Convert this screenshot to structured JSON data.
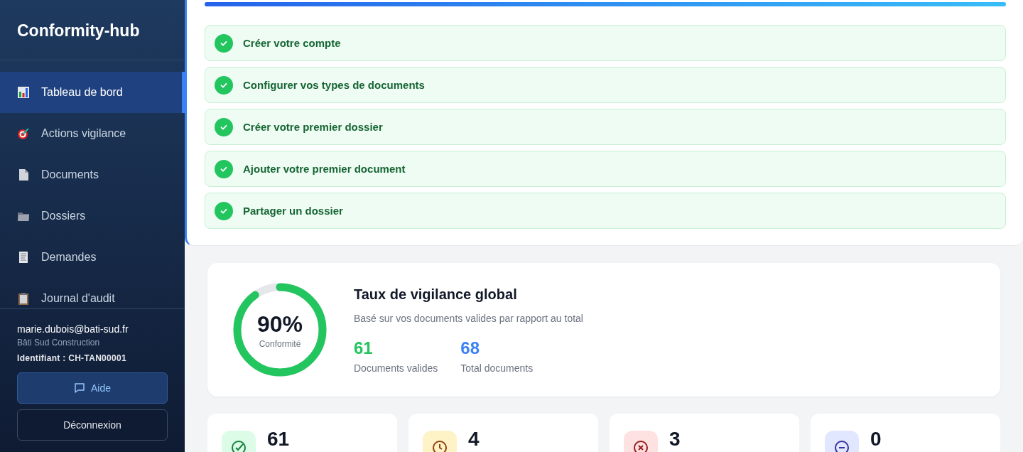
{
  "sidebar": {
    "brand": "Conformity-hub",
    "items": [
      {
        "label": "Tableau de bord",
        "kind": "chart",
        "selected": true
      },
      {
        "label": "Actions vigilance",
        "kind": "target",
        "selected": false
      },
      {
        "label": "Documents",
        "kind": "page",
        "selected": false
      },
      {
        "label": "Dossiers",
        "kind": "folder",
        "selected": false
      },
      {
        "label": "Demandes",
        "kind": "receipt",
        "selected": false
      },
      {
        "label": "Journal d'audit",
        "kind": "clipboard",
        "selected": false
      }
    ],
    "user": {
      "email": "marie.dubois@bati-sud.fr",
      "company": "Bâti Sud Construction",
      "identifier": "Identifiant : CH-TAN00001"
    },
    "help_button": "Aide",
    "logout_button": "Déconnexion"
  },
  "onboarding": {
    "progress": {
      "level": 1
    },
    "steps": [
      {
        "label": "Créer votre compte",
        "done": true
      },
      {
        "label": "Configurer vos types de documents",
        "done": true
      },
      {
        "label": "Créer votre premier dossier",
        "done": true
      },
      {
        "label": "Ajouter votre premier document",
        "done": true
      },
      {
        "label": "Partager un dossier",
        "done": true
      }
    ]
  },
  "vigilance": {
    "gauge": {
      "level": 0.9,
      "value": "90%",
      "caption": "Conformité"
    },
    "title": "Taux de vigilance global",
    "subtitle": "Basé sur vos documents valides par rapport au total",
    "figures": [
      {
        "value": "61",
        "label": "Documents valides",
        "kind": "valid"
      },
      {
        "value": "68",
        "label": "Total documents",
        "kind": "total"
      }
    ]
  },
  "stat_cards": [
    {
      "value": "61",
      "kind": "valid"
    },
    {
      "value": "4",
      "kind": "pending"
    },
    {
      "value": "3",
      "kind": "expired"
    },
    {
      "value": "0",
      "kind": "missing"
    }
  ]
}
